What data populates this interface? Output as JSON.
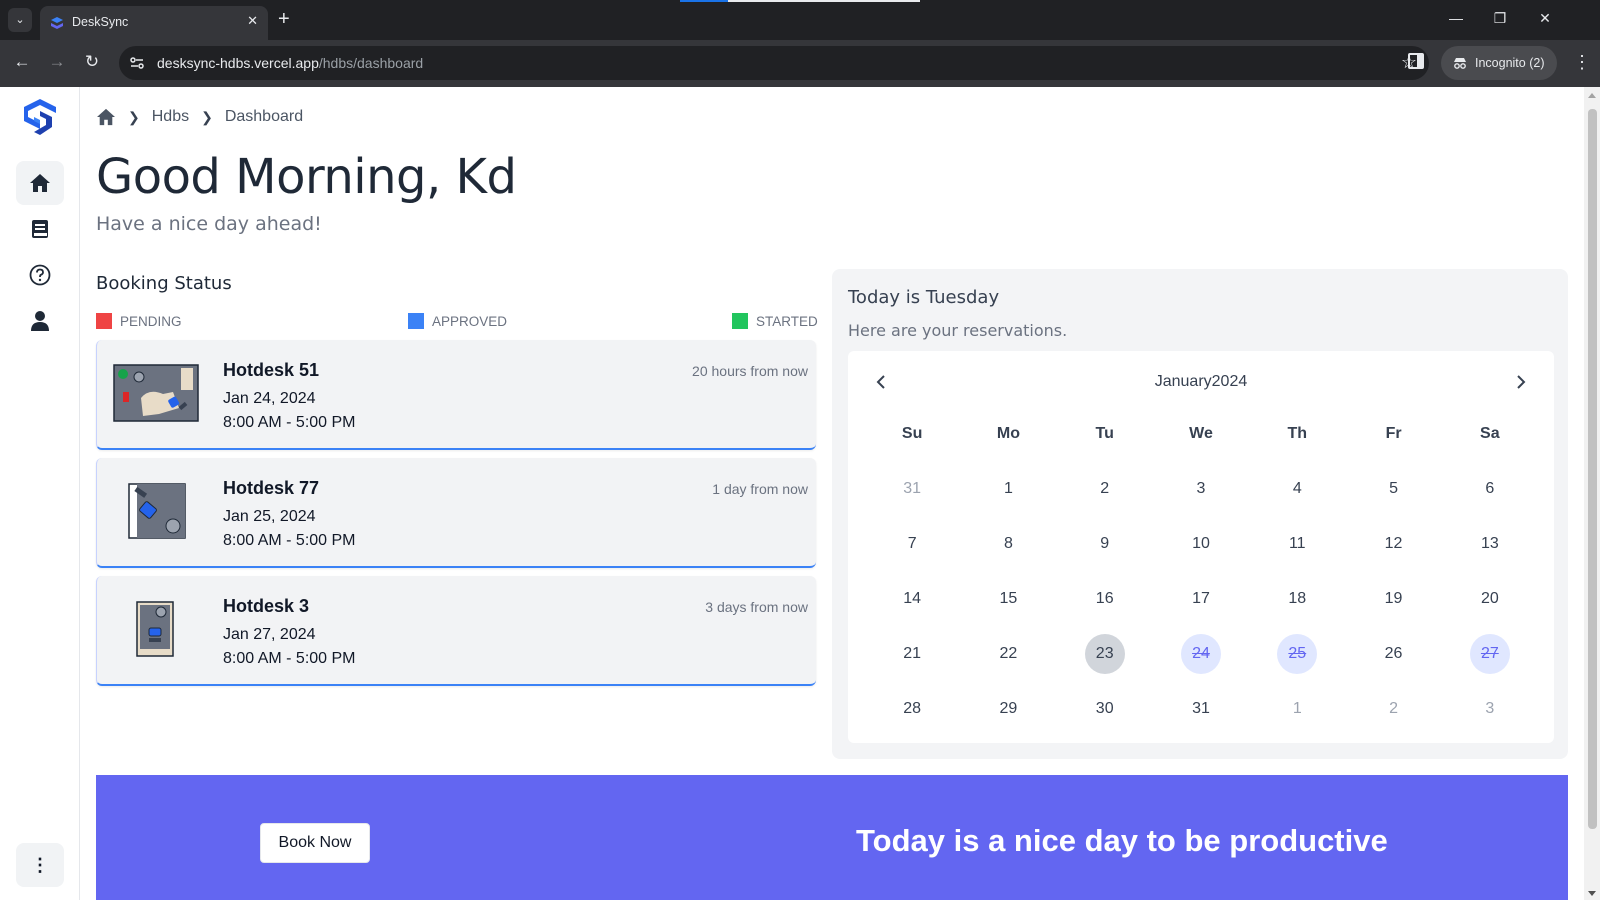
{
  "browser": {
    "tab_title": "DeskSync",
    "tab_close": "✕",
    "new_tab": "+",
    "url_host": "desksync-hdbs.vercel.app",
    "url_path": "/hdbs/dashboard",
    "incognito_label": "Incognito (2)",
    "icons": {
      "back": "back-arrow-icon",
      "forward": "forward-arrow-icon",
      "reload": "reload-icon",
      "star": "bookmark-star-icon",
      "menu": "kebab-menu-icon"
    }
  },
  "sidebar": {
    "items": [
      {
        "icon": "home-icon",
        "active": true
      },
      {
        "icon": "book-icon",
        "active": false
      },
      {
        "icon": "help-icon",
        "active": false
      },
      {
        "icon": "user-icon",
        "active": false
      }
    ],
    "more_label": "⋮"
  },
  "breadcrumb": {
    "items": [
      "Hdbs",
      "Dashboard"
    ]
  },
  "greeting": {
    "title": "Good Morning, Kd",
    "subtitle": "Have a nice day ahead!"
  },
  "booking_status": {
    "title": "Booking Status",
    "legend": [
      {
        "label": "PENDING",
        "color": "#ef4444"
      },
      {
        "label": "APPROVED",
        "color": "#3b82f6"
      },
      {
        "label": "STARTED",
        "color": "#22c55e"
      }
    ],
    "bookings": [
      {
        "name": "Hotdesk 51",
        "date": "Jan 24, 2024",
        "time": "8:00 AM - 5:00 PM",
        "relative": "20 hours from now"
      },
      {
        "name": "Hotdesk 77",
        "date": "Jan 25, 2024",
        "time": "8:00 AM - 5:00 PM",
        "relative": "1 day from now"
      },
      {
        "name": "Hotdesk 3",
        "date": "Jan 27, 2024",
        "time": "8:00 AM - 5:00 PM",
        "relative": "3 days from now"
      }
    ]
  },
  "calendar": {
    "today_label": "Today is Tuesday",
    "subtitle": "Here are your reservations.",
    "month_label": "January2024",
    "weekdays": [
      "Su",
      "Mo",
      "Tu",
      "We",
      "Th",
      "Fr",
      "Sa"
    ],
    "days": [
      {
        "d": "31",
        "outside": true
      },
      {
        "d": "1"
      },
      {
        "d": "2"
      },
      {
        "d": "3"
      },
      {
        "d": "4"
      },
      {
        "d": "5"
      },
      {
        "d": "6"
      },
      {
        "d": "7"
      },
      {
        "d": "8"
      },
      {
        "d": "9"
      },
      {
        "d": "10"
      },
      {
        "d": "11"
      },
      {
        "d": "12"
      },
      {
        "d": "13"
      },
      {
        "d": "14"
      },
      {
        "d": "15"
      },
      {
        "d": "16"
      },
      {
        "d": "17"
      },
      {
        "d": "18"
      },
      {
        "d": "19"
      },
      {
        "d": "20"
      },
      {
        "d": "21"
      },
      {
        "d": "22"
      },
      {
        "d": "23",
        "today": true
      },
      {
        "d": "24",
        "booked": true
      },
      {
        "d": "25",
        "booked": true
      },
      {
        "d": "26"
      },
      {
        "d": "27",
        "booked": true
      },
      {
        "d": "28"
      },
      {
        "d": "29"
      },
      {
        "d": "30"
      },
      {
        "d": "31"
      },
      {
        "d": "1",
        "outside": true
      },
      {
        "d": "2",
        "outside": true
      },
      {
        "d": "3",
        "outside": true
      }
    ]
  },
  "banner": {
    "button_label": "Book Now",
    "text": "Today is a nice day to be productive",
    "color": "#6366f1"
  }
}
